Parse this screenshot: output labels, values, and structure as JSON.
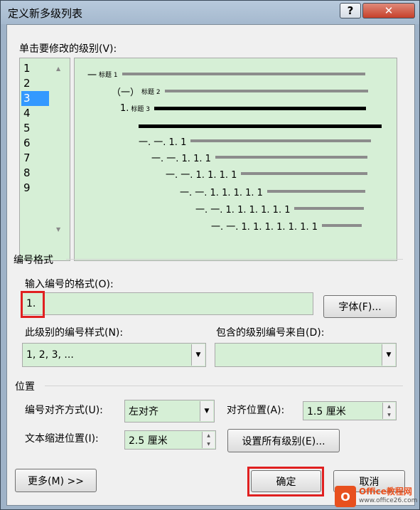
{
  "window": {
    "title": "定义新多级列表",
    "help_glyph": "?",
    "close_glyph": "✕"
  },
  "level_list": {
    "label": "单击要修改的级别(V):",
    "items": [
      "1",
      "2",
      "3",
      "4",
      "5",
      "6",
      "7",
      "8",
      "9"
    ],
    "selected": "3"
  },
  "preview": {
    "line1": {
      "prefix": "一",
      "text": "标题 1"
    },
    "line2": {
      "prefix": "（一）",
      "text": "标题 2"
    },
    "line3": {
      "prefix": "1.",
      "text": "标题 3"
    },
    "nums": [
      "一. 一. 1. 1",
      "一. 一. 1. 1. 1",
      "一. 一. 1. 1. 1. 1",
      "一. 一. 1. 1. 1. 1. 1",
      "一. 一. 1. 1. 1. 1. 1. 1",
      "一. 一. 1. 1. 1. 1. 1. 1. 1"
    ]
  },
  "number_format": {
    "section_title": "编号格式",
    "input_label": "输入编号的格式(O):",
    "input_value": "1.",
    "font_button": "字体(F)...",
    "style_label": "此级别的编号样式(N):",
    "style_value": "1, 2, 3, ...",
    "include_label": "包含的级别编号来自(D):",
    "include_value": ""
  },
  "position": {
    "section_title": "位置",
    "align_label": "编号对齐方式(U):",
    "align_value": "左对齐",
    "align_at_label": "对齐位置(A):",
    "align_at_value": "1.5 厘米",
    "indent_label": "文本缩进位置(I):",
    "indent_value": "2.5 厘米",
    "set_all_button": "设置所有级别(E)..."
  },
  "footer": {
    "more_button": "更多(M) >>",
    "ok_button": "确定",
    "cancel_button": "取消"
  },
  "watermark": {
    "line1": "Office教程网",
    "line2": "www.office26.com"
  },
  "colors": {
    "field_bg": "#d6efd6",
    "selection": "#3399ff",
    "highlight": "#e02020"
  }
}
